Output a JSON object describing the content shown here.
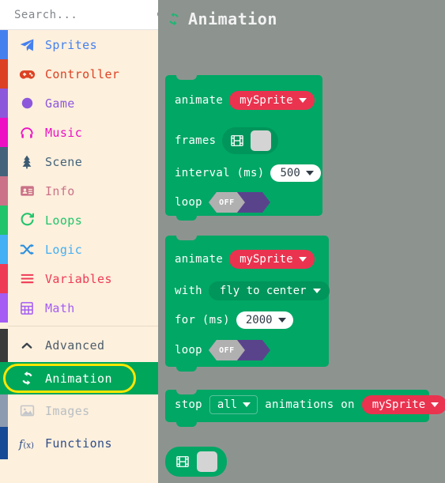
{
  "search": {
    "placeholder": "Search...",
    "value": "",
    "icon": "search-icon"
  },
  "sidebar": {
    "background": "#fdf0dd",
    "selected_highlight": "#ffe600",
    "selected_bg": "#00a65a",
    "items": [
      {
        "label": "Sprites",
        "color": "#4580ef",
        "stripe": "#4580ef",
        "icon": "paper-plane-icon",
        "selected": false,
        "dimmed": false
      },
      {
        "label": "Controller",
        "color": "#dc4123",
        "stripe": "#dc4123",
        "icon": "gamepad-icon",
        "selected": false,
        "dimmed": false
      },
      {
        "label": "Game",
        "color": "#8d57dc",
        "stripe": "#8d57dc",
        "icon": "circle-icon",
        "selected": false,
        "dimmed": false
      },
      {
        "label": "Music",
        "color": "#ec0fc4",
        "stripe": "#ec0fc4",
        "icon": "headphones-icon",
        "selected": false,
        "dimmed": false
      },
      {
        "label": "Scene",
        "color": "#44637b",
        "stripe": "#44637b",
        "icon": "tree-icon",
        "selected": false,
        "dimmed": false
      },
      {
        "label": "Info",
        "color": "#cb7288",
        "stripe": "#cb7288",
        "icon": "id-card-icon",
        "selected": false,
        "dimmed": false
      },
      {
        "label": "Loops",
        "color": "#21c46b",
        "stripe": "#21c46b",
        "icon": "refresh-icon",
        "selected": false,
        "dimmed": false
      },
      {
        "label": "Logic",
        "color": "#43aff4",
        "stripe": "#43aff4",
        "icon": "shuffle-icon",
        "selected": false,
        "dimmed": false
      },
      {
        "label": "Variables",
        "color": "#ef3a55",
        "stripe": "#ef3a55",
        "icon": "lines-icon",
        "selected": false,
        "dimmed": false
      },
      {
        "label": "Math",
        "color": "#a45cf4",
        "stripe": "#a45cf4",
        "icon": "calculator-icon",
        "selected": false,
        "dimmed": false
      }
    ],
    "advanced_group": [
      {
        "label": "Advanced",
        "color": "#4f5d6b",
        "stripe": "#3a3a3a",
        "icon": "chevron-up-icon",
        "selected": false,
        "dimmed": false
      },
      {
        "label": "Animation",
        "color": "#ffffff",
        "stripe": "#00a65a",
        "icon": "animation-icon",
        "selected": true,
        "dimmed": false
      },
      {
        "label": "Images",
        "color": "#b9bec3",
        "stripe": "#8d9bb0",
        "icon": "picture-icon",
        "selected": false,
        "dimmed": true
      },
      {
        "label": "Functions",
        "color": "#2f4d88",
        "stripe": "#164a96",
        "icon": "function-icon",
        "selected": false,
        "dimmed": false
      }
    ]
  },
  "flyout": {
    "title": "Animation",
    "title_icon": "animation-icon",
    "background": "#8d9490",
    "block_color": "#00a765",
    "variable_color": "#ea334f",
    "toggle_on_color": "#59448c",
    "blocks": [
      {
        "name": "animate-frames-block",
        "rows": [
          {
            "label": "animate",
            "field": {
              "kind": "variable",
              "value": "mySprite"
            }
          },
          {
            "label": "frames",
            "field": {
              "kind": "frames",
              "value": ""
            }
          },
          {
            "label": "interval (ms)",
            "field": {
              "kind": "number",
              "value": "500"
            }
          },
          {
            "label": "loop",
            "field": {
              "kind": "toggle",
              "value": "OFF"
            }
          }
        ]
      },
      {
        "name": "animate-effect-block",
        "rows": [
          {
            "label": "animate",
            "field": {
              "kind": "variable",
              "value": "mySprite"
            }
          },
          {
            "label": "with",
            "field": {
              "kind": "dark",
              "value": "fly to center"
            }
          },
          {
            "label": "for (ms)",
            "field": {
              "kind": "number",
              "value": "2000"
            }
          },
          {
            "label": "loop",
            "field": {
              "kind": "toggle",
              "value": "OFF"
            }
          }
        ]
      },
      {
        "name": "stop-animations-block",
        "inline": {
          "lead": "stop",
          "scope": "all",
          "mid": "animations on",
          "target": "mySprite"
        }
      },
      {
        "name": "frames-reporter-block",
        "reporter": {
          "icon": "film-icon",
          "value": ""
        }
      }
    ]
  }
}
